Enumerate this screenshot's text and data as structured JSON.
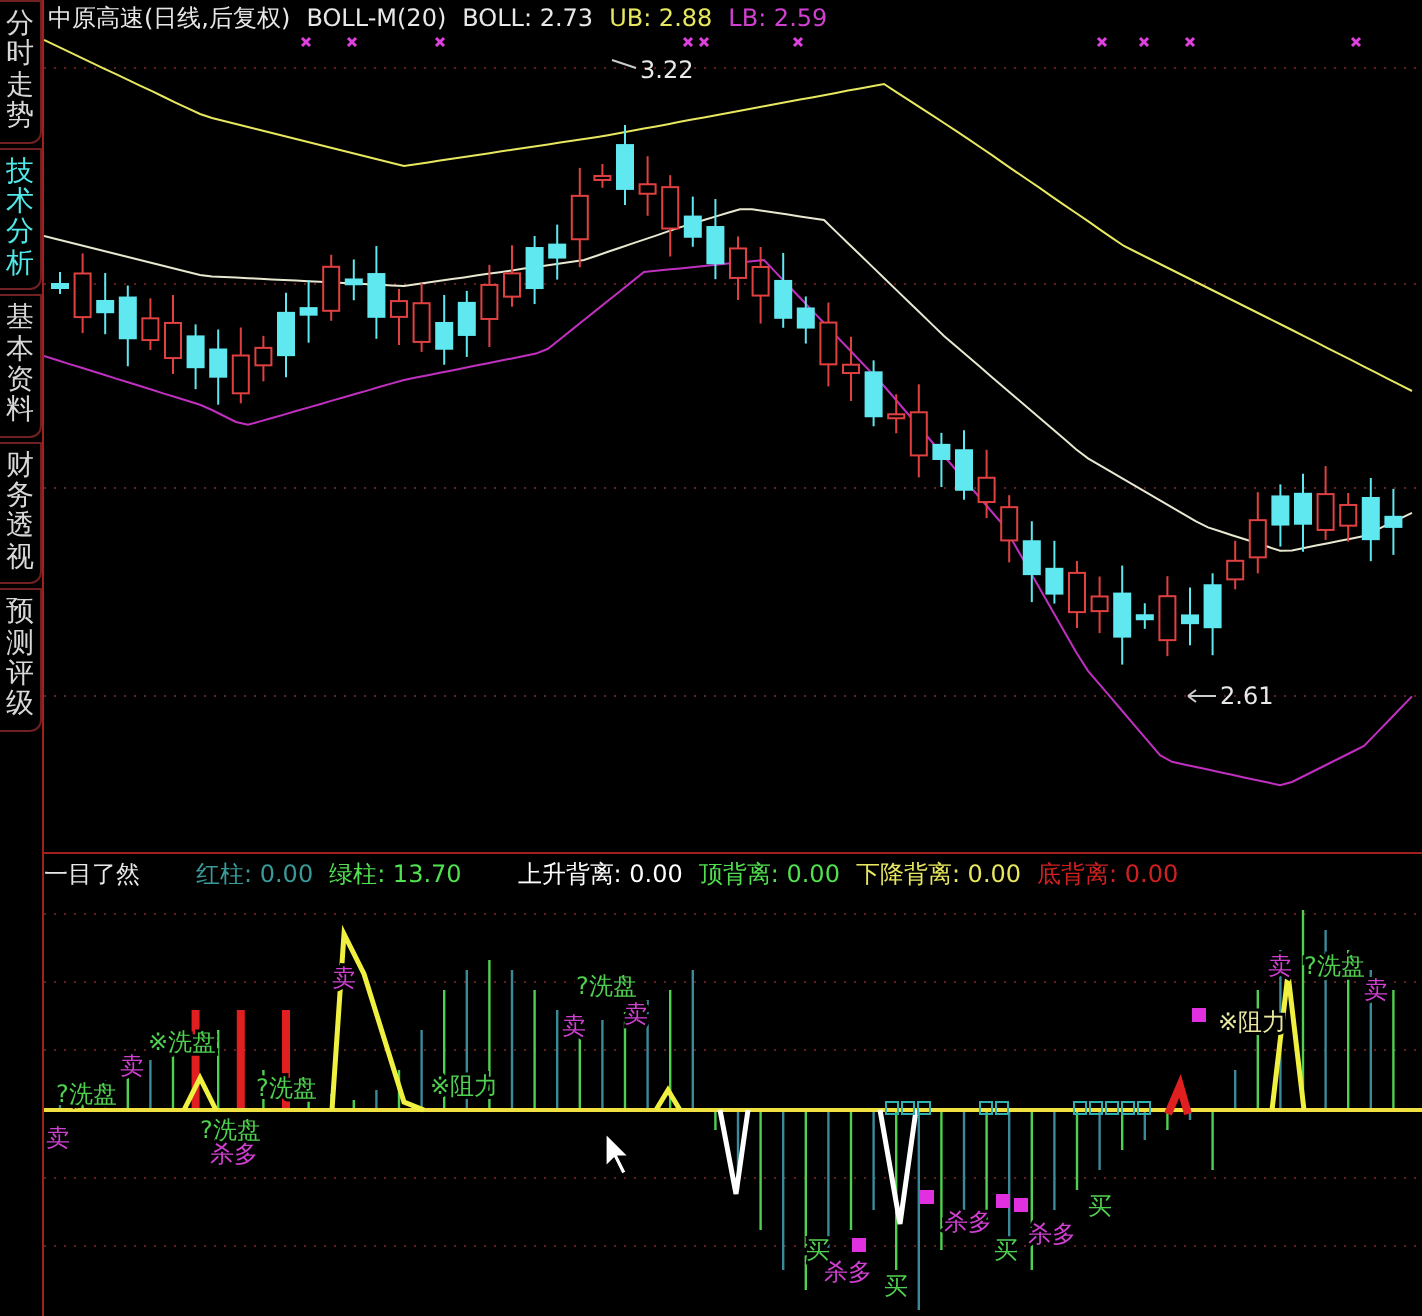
{
  "sidebar": {
    "tabs": [
      {
        "label": "分时走势",
        "selected": false
      },
      {
        "label": "技术分析",
        "selected": true
      },
      {
        "label": "基本资料",
        "selected": false
      },
      {
        "label": "财务透视",
        "selected": false
      },
      {
        "label": "预测评级",
        "selected": false
      }
    ]
  },
  "main_chart": {
    "legend": [
      {
        "text": "中原高速(日线,后复权)",
        "color": "#e8e8e8"
      },
      {
        "text": "BOLL-M(20)",
        "color": "#e8e8e8"
      },
      {
        "text": "BOLL: 2.73",
        "color": "#e8e8e8"
      },
      {
        "text": "UB: 2.88",
        "color": "#e8e860"
      },
      {
        "text": "LB: 2.59",
        "color": "#d040d0"
      }
    ],
    "high_label": "3.22",
    "low_label": "2.61"
  },
  "indicator": {
    "title": "一目了然",
    "legend": [
      {
        "text": "红柱: 0.00",
        "color": "#3a9a9a"
      },
      {
        "text": "绿柱: 13.70",
        "color": "#50e050"
      },
      {
        "text": "上升背离: 0.00",
        "color": "#ffffff"
      },
      {
        "text": "顶背离: 0.00",
        "color": "#50e050"
      },
      {
        "text": "下降背离: 0.00",
        "color": "#e8e860"
      },
      {
        "text": "底背离: 0.00",
        "color": "#d02020"
      }
    ],
    "signals": [
      {
        "text": "卖",
        "kind": "sell"
      },
      {
        "text": "?洗盘",
        "kind": "wash"
      },
      {
        "text": "卖",
        "kind": "sell"
      },
      {
        "text": "※洗盘",
        "kind": "wash"
      },
      {
        "text": "?洗盘",
        "kind": "wash"
      },
      {
        "text": "杀多",
        "kind": "kill"
      },
      {
        "text": "?洗盘",
        "kind": "wash"
      },
      {
        "text": "卖",
        "kind": "sell"
      },
      {
        "text": "※阻力",
        "kind": "wash"
      },
      {
        "text": "?洗盘",
        "kind": "wash"
      },
      {
        "text": "卖",
        "kind": "sell"
      },
      {
        "text": "卖",
        "kind": "sell"
      },
      {
        "text": "买",
        "kind": "buy"
      },
      {
        "text": "杀多",
        "kind": "kill"
      },
      {
        "text": "买",
        "kind": "buy"
      },
      {
        "text": "杀多",
        "kind": "kill"
      },
      {
        "text": "买",
        "kind": "buy"
      },
      {
        "text": "杀多",
        "kind": "kill"
      },
      {
        "text": "买",
        "kind": "buy"
      },
      {
        "text": "※阻力",
        "kind": "resist"
      },
      {
        "text": "卖",
        "kind": "sell"
      },
      {
        "text": "?洗盘",
        "kind": "wash"
      },
      {
        "text": "卖",
        "kind": "sell"
      }
    ]
  }
}
